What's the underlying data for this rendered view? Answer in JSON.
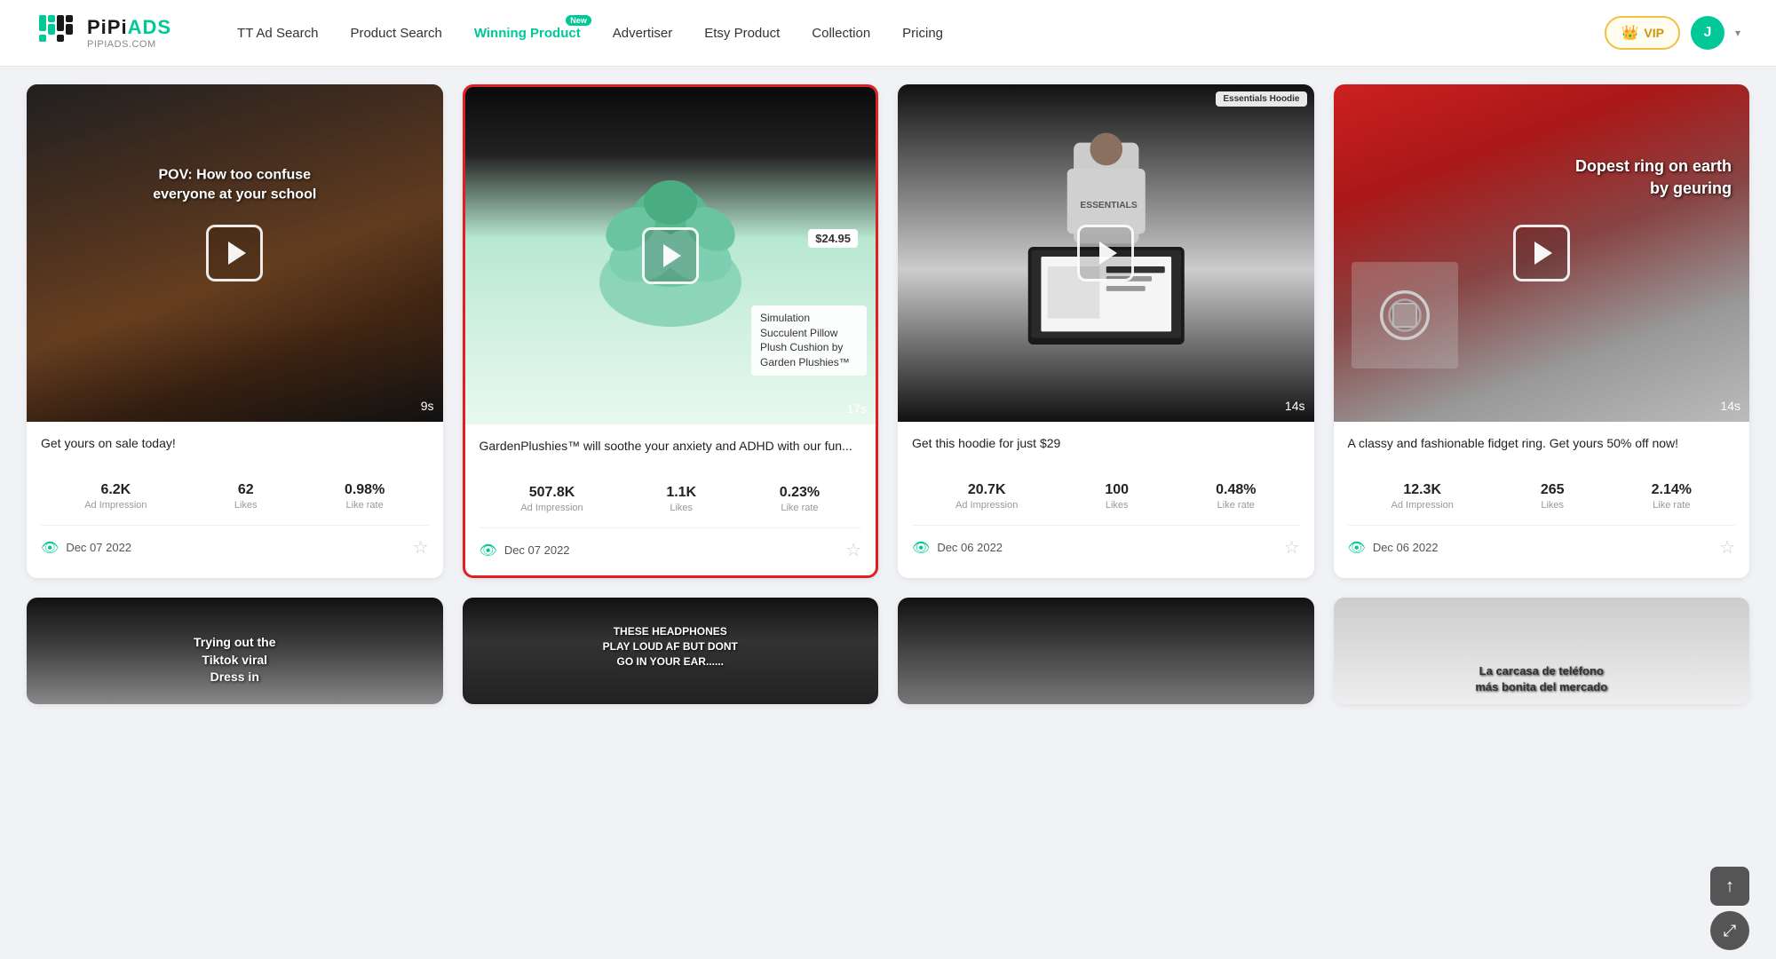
{
  "header": {
    "logo_main": "PiPiADS",
    "logo_sub": "PIPIADS.COM",
    "nav_items": [
      {
        "id": "tt-ad-search",
        "label": "TT Ad Search",
        "active": false,
        "badge": null
      },
      {
        "id": "product-search",
        "label": "Product Search",
        "active": false,
        "badge": null
      },
      {
        "id": "winning-product",
        "label": "Winning Product",
        "active": true,
        "badge": "New"
      },
      {
        "id": "advertiser",
        "label": "Advertiser",
        "active": false,
        "badge": null
      },
      {
        "id": "etsy-product",
        "label": "Etsy Product",
        "active": false,
        "badge": null
      },
      {
        "id": "collection",
        "label": "Collection",
        "active": false,
        "badge": null
      },
      {
        "id": "pricing",
        "label": "Pricing",
        "active": false,
        "badge": null
      }
    ],
    "vip_label": "VIP",
    "avatar_letter": "J"
  },
  "cards": [
    {
      "id": "card-1",
      "thumb_class": "thumb-1",
      "caption": "POV: How too confuse everyone at your school",
      "duration": "9s",
      "title": "Get yours on sale today!",
      "ad_impression": "6.2K",
      "likes": "62",
      "like_rate": "0.98%",
      "date": "Dec 07 2022",
      "highlighted": false,
      "price_tag": null,
      "product_label": null
    },
    {
      "id": "card-2",
      "thumb_class": "thumb-2",
      "caption": null,
      "duration": "17s",
      "title": "GardenPlushies™ will soothe your anxiety and ADHD with our fun...",
      "ad_impression": "507.8K",
      "likes": "1.1K",
      "like_rate": "0.23%",
      "date": "Dec 07 2022",
      "highlighted": true,
      "price_tag": "$24.95",
      "product_label": "Simulation Succulent Pillow Plush Cushion by Garden Plushies™"
    },
    {
      "id": "card-3",
      "thumb_class": "thumb-3",
      "caption": null,
      "duration": "14s",
      "title": "Get this hoodie for just $29",
      "ad_impression": "20.7K",
      "likes": "100",
      "like_rate": "0.48%",
      "date": "Dec 06 2022",
      "highlighted": false,
      "price_tag": null,
      "product_label": null
    },
    {
      "id": "card-4",
      "thumb_class": "thumb-4",
      "caption": null,
      "duration": "14s",
      "title": "A classy and fashionable fidget ring. Get yours 50% off now!",
      "ad_impression": "12.3K",
      "likes": "265",
      "like_rate": "2.14%",
      "date": "Dec 06 2022",
      "highlighted": false,
      "price_tag": null,
      "product_label": null
    }
  ],
  "bottom_row": [
    {
      "id": "b1",
      "thumb_class": "thumb-5",
      "caption_type": "tiktok"
    },
    {
      "id": "b2",
      "thumb_class": "thumb-6",
      "caption_type": "headphones"
    },
    {
      "id": "b3",
      "thumb_class": "thumb-7",
      "caption_type": "none"
    },
    {
      "id": "b4",
      "thumb_class": "thumb-8",
      "caption_type": "phone"
    }
  ],
  "labels": {
    "ad_impression": "Ad Impression",
    "likes": "Likes",
    "like_rate": "Like rate"
  },
  "bottom_captions": {
    "tiktok": "Trying out the\nTiktok viral\nDress in",
    "headphones": "THESE HEADPHONES\nPLAY LOUD AF BUT DONT\nGO IN YOUR EAR......",
    "phone": "La carcasa de teléfono\nmás bonita del mercado"
  }
}
